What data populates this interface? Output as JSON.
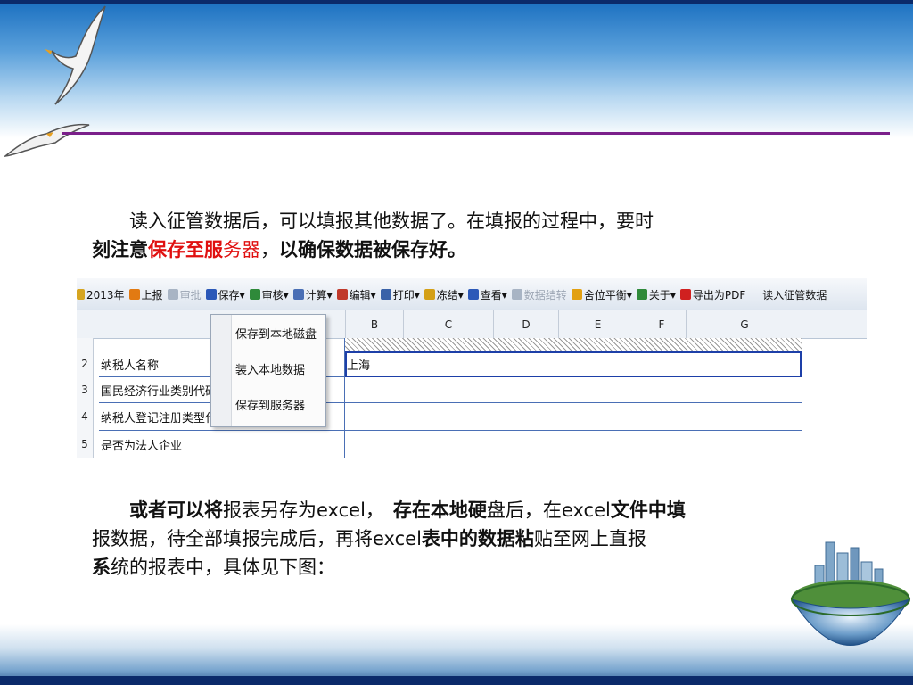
{
  "paragraph1": {
    "s1": "读入征管数据后，可以填报其他数据了。在填报的过程中，要时",
    "s2": "刻注意",
    "s3": "保存至服",
    "s4": "务器",
    "s5": "，",
    "s6": "以确保数据被保存好。"
  },
  "paragraph2": {
    "s1": "或者可以将",
    "s2": "报表另存为",
    "s3": "excel，",
    "s4": "存在本地硬",
    "s5": "盘后，在",
    "s6": "excel",
    "s7": "文件中填",
    "s8": "报数据，待全部填报完成后，再将",
    "s9": "excel",
    "s10": "表中的数据粘",
    "s11": "贴至网上直报",
    "s12": "系",
    "s13": "统的报表中，具体见下图："
  },
  "toolbar": {
    "items": [
      {
        "label": "2013年",
        "icon": "form-icon",
        "color": "#d6a520",
        "disabled": false
      },
      {
        "label": "上报",
        "icon": "upload-icon",
        "color": "#e27a12",
        "disabled": false
      },
      {
        "label": "审批",
        "icon": "approve-icon",
        "color": "#a8b4c4",
        "disabled": true
      },
      {
        "label": "保存▾",
        "icon": "save-icon",
        "color": "#2b58b8",
        "disabled": false
      },
      {
        "label": "审核▾",
        "icon": "audit-icon",
        "color": "#2f8a3a",
        "disabled": false
      },
      {
        "label": "计算▾",
        "icon": "calc-icon",
        "color": "#4a6fb5",
        "disabled": false
      },
      {
        "label": "编辑▾",
        "icon": "edit-icon",
        "color": "#c0392b",
        "disabled": false
      },
      {
        "label": "打印▾",
        "icon": "print-icon",
        "color": "#3a62a8",
        "disabled": false
      },
      {
        "label": "冻结▾",
        "icon": "lock-icon",
        "color": "#d4a017",
        "disabled": false
      },
      {
        "label": "查看▾",
        "icon": "view-icon",
        "color": "#2b58b8",
        "disabled": false
      },
      {
        "label": "数据结转",
        "icon": "transfer-icon",
        "color": "#a8b4c4",
        "disabled": true
      },
      {
        "label": "舍位平衡▾",
        "icon": "balance-icon",
        "color": "#e2a012",
        "disabled": false
      },
      {
        "label": "关于▾",
        "icon": "about-icon",
        "color": "#2f8a3a",
        "disabled": false
      },
      {
        "label": "导出为PDF",
        "icon": "pdf-icon",
        "color": "#d02020",
        "disabled": false
      },
      {
        "label": "读入征管数据",
        "icon": "",
        "color": "",
        "disabled": false
      }
    ]
  },
  "columns": [
    "B",
    "C",
    "D",
    "E",
    "F",
    "G"
  ],
  "rows": [
    {
      "num": "2",
      "label": "纳税人名称",
      "value": "上海"
    },
    {
      "num": "3",
      "label": "国民经济行业类别代码",
      "value": ""
    },
    {
      "num": "4",
      "label": "纳税人登记注册类型代码",
      "value": ""
    },
    {
      "num": "5",
      "label": "是否为法人企业",
      "value": ""
    }
  ],
  "save_menu": {
    "items": [
      "保存到本地磁盘",
      "装入本地数据",
      "保存到服务器"
    ]
  }
}
